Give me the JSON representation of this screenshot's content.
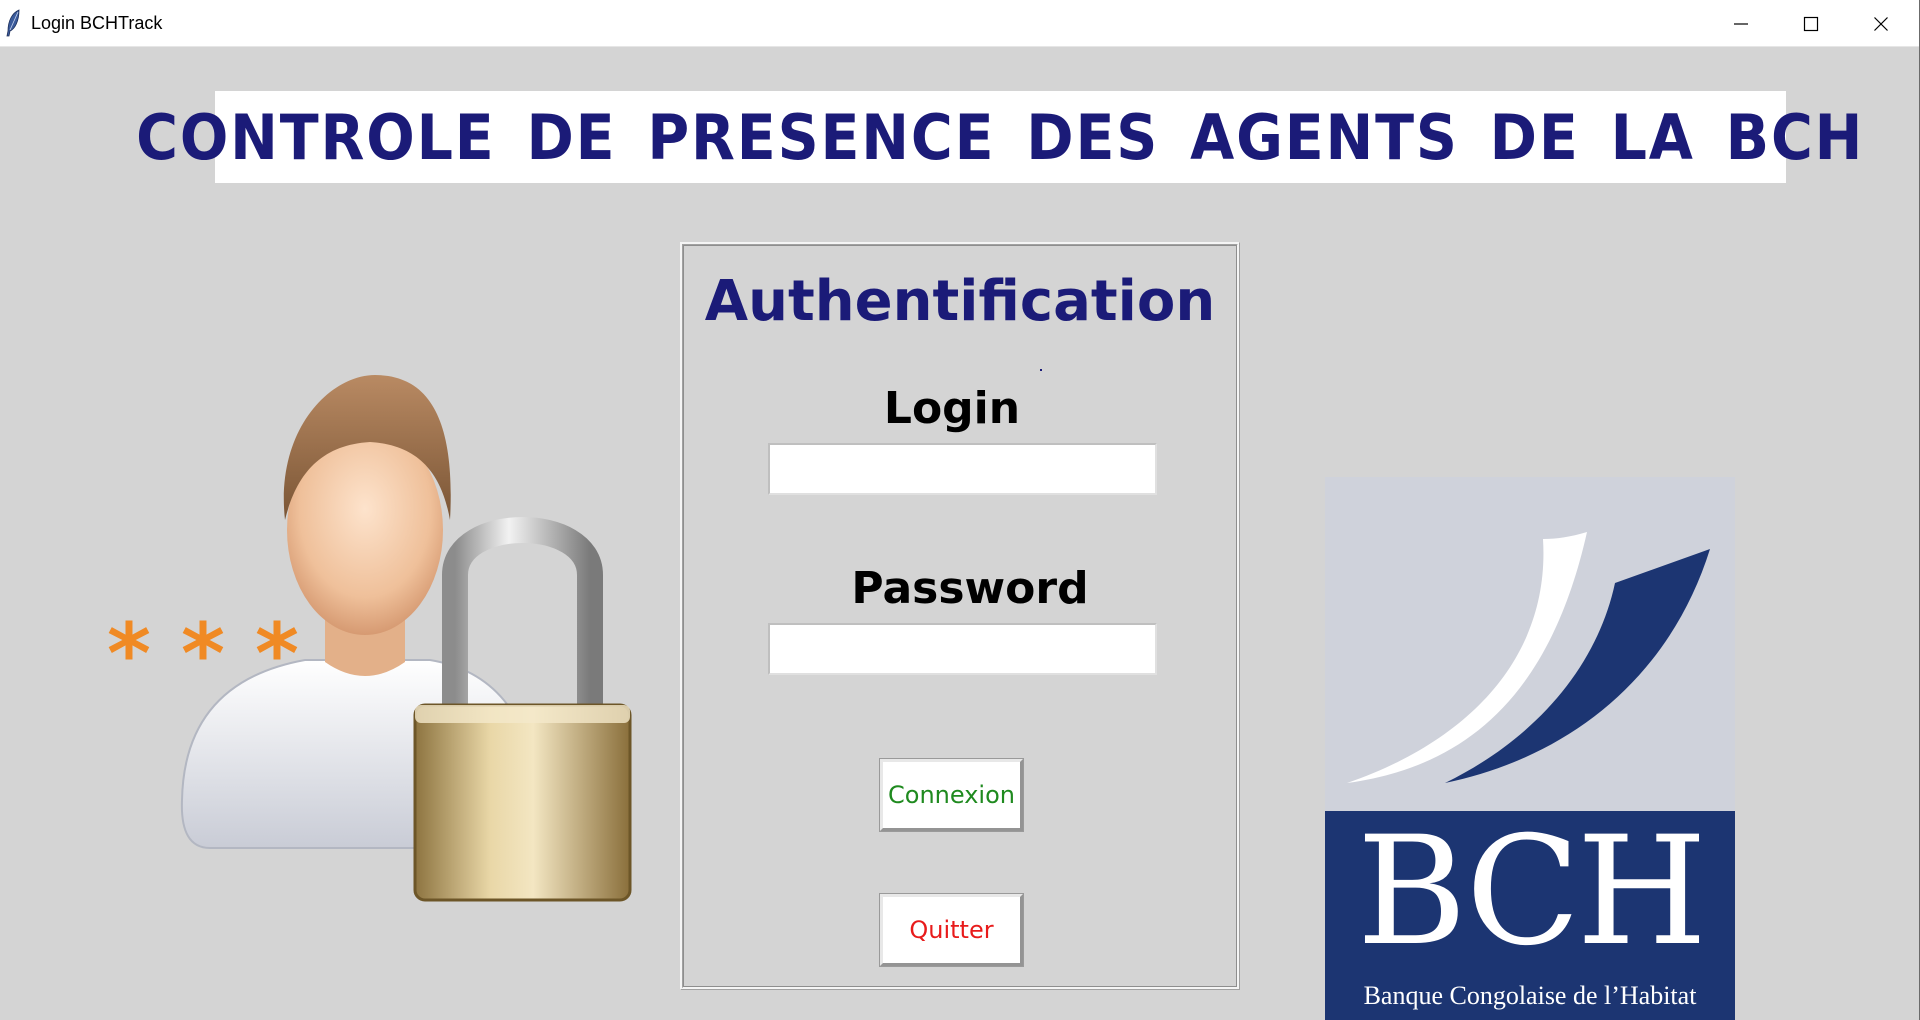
{
  "window": {
    "title": "Login BCHTrack",
    "controls": {
      "minimize": "minimize-icon",
      "maximize": "maximize-icon",
      "close": "close-icon"
    }
  },
  "banner": {
    "title": "CONTROLE DE PRESENCE DES AGENTS DE LA BCH"
  },
  "illustration": {
    "asterisks": [
      "*",
      "*",
      "*"
    ],
    "icons": [
      "user-icon",
      "padlock-icon"
    ]
  },
  "auth": {
    "title": "Authentification",
    "login_label": "Login",
    "login_value": "",
    "password_label": "Password",
    "password_value": "",
    "connect_label": "Connexion",
    "quit_label": "Quitter"
  },
  "logo": {
    "letters": "BCH",
    "subtitle": "Banque Congolaise de l’Habitat"
  },
  "colors": {
    "background": "#d4d4d4",
    "title_navy": "#1b1b78",
    "connect_green": "#1f8a1f",
    "quit_red": "#e81b1b",
    "asterisk_orange": "#f08a24",
    "logo_navy": "#1c3572"
  }
}
